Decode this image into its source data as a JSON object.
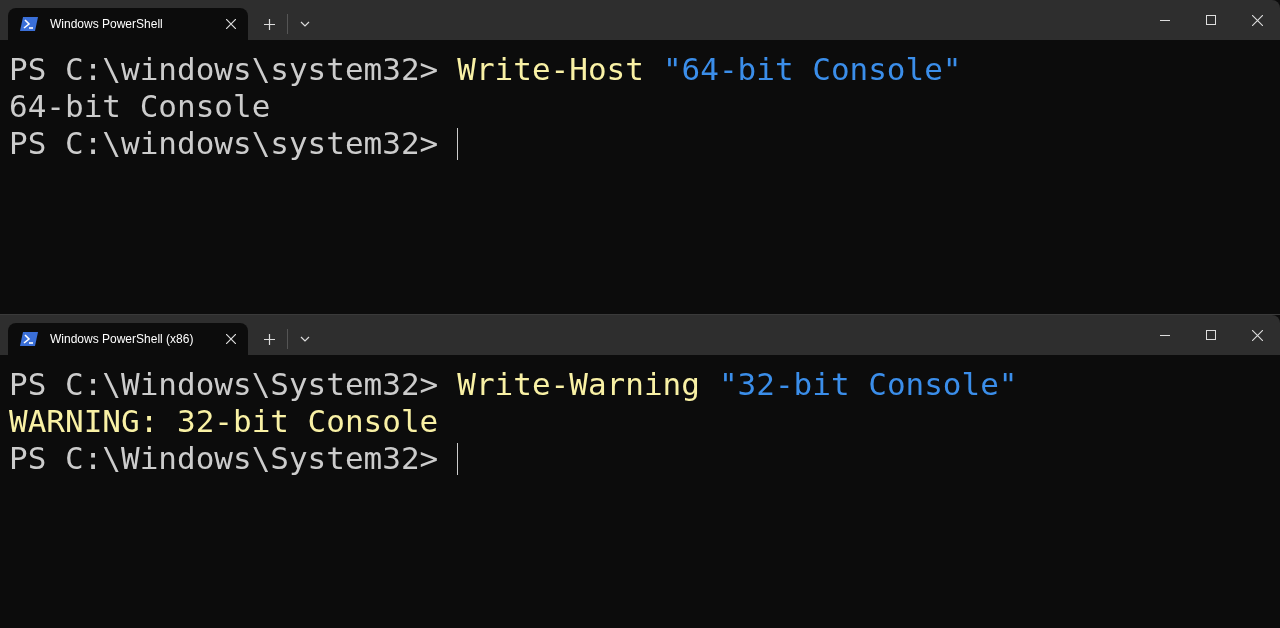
{
  "windows": [
    {
      "tabs": [
        {
          "title": "Windows PowerShell",
          "selected": true
        }
      ],
      "lines": [
        {
          "cursor": false,
          "segments": [
            {
              "kind": "prompt",
              "text": "PS C:\\windows\\system32>"
            },
            {
              "kind": "command",
              "text": "Write-Host"
            },
            {
              "kind": "string",
              "text": "\"64-bit Console\""
            }
          ]
        },
        {
          "cursor": false,
          "segments": [
            {
              "kind": "output",
              "text": "64-bit Console"
            }
          ]
        },
        {
          "cursor": true,
          "segments": [
            {
              "kind": "prompt",
              "text": "PS C:\\windows\\system32>"
            }
          ]
        }
      ]
    },
    {
      "tabs": [
        {
          "title": "Windows PowerShell (x86)",
          "selected": true
        }
      ],
      "lines": [
        {
          "cursor": false,
          "segments": [
            {
              "kind": "prompt",
              "text": "PS C:\\Windows\\System32>"
            },
            {
              "kind": "command",
              "text": "Write-Warning"
            },
            {
              "kind": "string",
              "text": "\"32-bit Console\""
            }
          ]
        },
        {
          "cursor": false,
          "segments": [
            {
              "kind": "warning",
              "text": "WARNING: 32-bit Console"
            }
          ]
        },
        {
          "cursor": true,
          "segments": [
            {
              "kind": "prompt",
              "text": "PS C:\\Windows\\System32>"
            }
          ]
        }
      ]
    }
  ]
}
